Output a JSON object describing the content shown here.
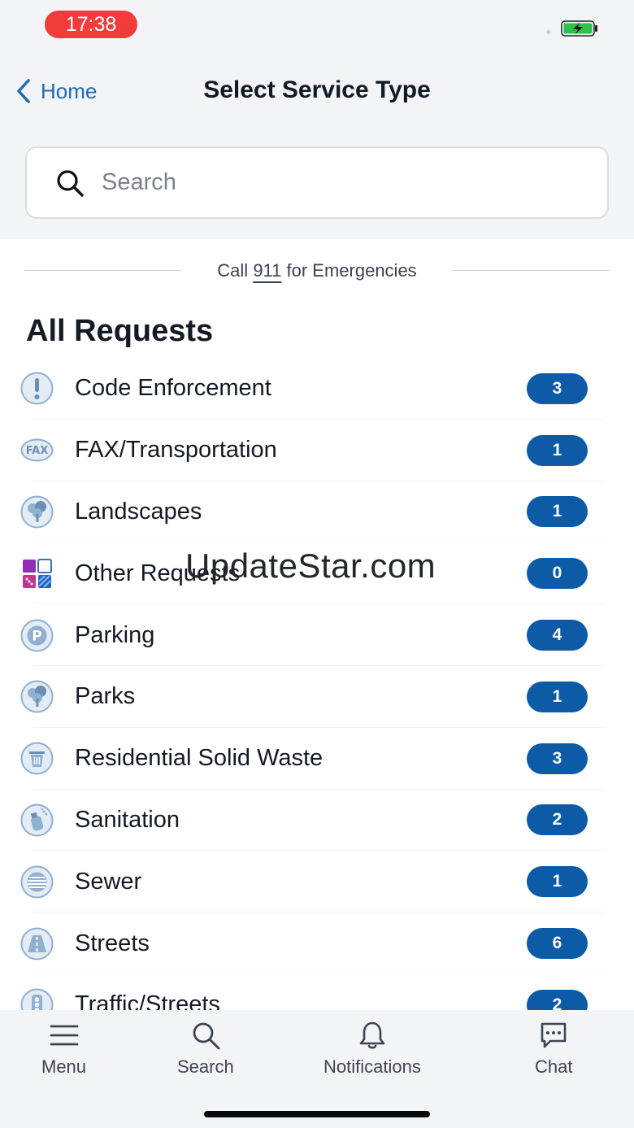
{
  "status_bar": {
    "time": "17:38",
    "battery_color": "#2fc24a",
    "time_pill_color": "#f23b3b"
  },
  "nav": {
    "back_label": "Home",
    "title": "Select Service Type"
  },
  "search": {
    "placeholder": "Search"
  },
  "emergency": {
    "prefix": "Call ",
    "number": "911",
    "suffix": " for Emergencies"
  },
  "section": {
    "title": "All Requests"
  },
  "accent_color": "#0d5aa7",
  "requests": [
    {
      "label": "Code Enforcement",
      "count": "3",
      "icon": "exclamation-icon"
    },
    {
      "label": "FAX/Transportation",
      "count": "1",
      "icon": "fax-icon"
    },
    {
      "label": "Landscapes",
      "count": "1",
      "icon": "tree-icon"
    },
    {
      "label": "Other Requests",
      "count": "0",
      "icon": "grid-icon"
    },
    {
      "label": "Parking",
      "count": "4",
      "icon": "parking-icon"
    },
    {
      "label": "Parks",
      "count": "1",
      "icon": "tree-icon"
    },
    {
      "label": "Residential Solid Waste",
      "count": "3",
      "icon": "trash-icon"
    },
    {
      "label": "Sanitation",
      "count": "2",
      "icon": "spray-icon"
    },
    {
      "label": "Sewer",
      "count": "1",
      "icon": "sewer-icon"
    },
    {
      "label": "Streets",
      "count": "6",
      "icon": "road-icon"
    },
    {
      "label": "Traffic/Streets",
      "count": "2",
      "icon": "traffic-light-icon"
    }
  ],
  "watermark": "UpdateStar.com",
  "tabs": [
    {
      "label": "Menu",
      "icon": "menu-icon"
    },
    {
      "label": "Search",
      "icon": "search-icon"
    },
    {
      "label": "Notifications",
      "icon": "bell-icon"
    },
    {
      "label": "Chat",
      "icon": "chat-icon"
    }
  ]
}
